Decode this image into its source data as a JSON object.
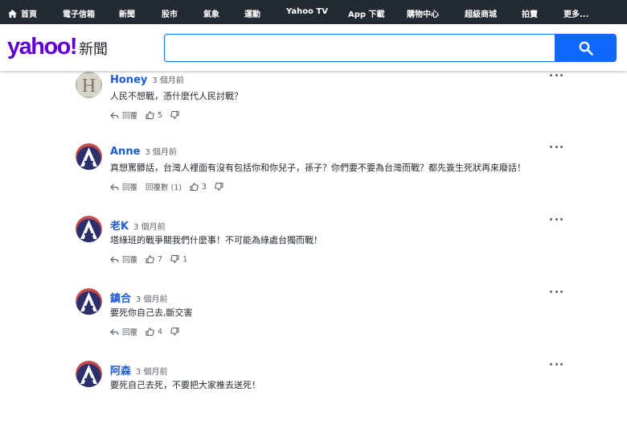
{
  "nav": {
    "items": [
      "首頁",
      "電子信箱",
      "新聞",
      "股市",
      "氣象",
      "運動",
      "Yahoo TV",
      "App 下載",
      "購物中心",
      "超級商城",
      "拍賣",
      "更多..."
    ]
  },
  "header": {
    "logo_text": "yahoo!",
    "section_text": "新聞",
    "search_value": ""
  },
  "comments": [
    {
      "author": "Honey",
      "time": "3 個月前",
      "text": "人民不想戰，憑什麼代人民討戰？",
      "reply_label": "回覆",
      "replies_label": "",
      "likes": "5",
      "dislikes": "",
      "avatar": "letter-H"
    },
    {
      "author": "Anne",
      "time": "3 個月前",
      "text": "真想罵髒話，台灣人裡面有沒有包括你和你兒子，孫子？你們要不要為台灣而戰？都先簽生死狀再來廢話！",
      "reply_label": "回覆",
      "replies_label": "回覆數 (1)",
      "likes": "3",
      "dislikes": "",
      "avatar": "letter-A"
    },
    {
      "author": "老K",
      "time": "3 個月前",
      "text": "塔綠班的戰爭關我們什麼事！不可能為綠處台獨而戰！",
      "reply_label": "回覆",
      "replies_label": "",
      "likes": "7",
      "dislikes": "1",
      "avatar": "letter-A"
    },
    {
      "author": "鎮合",
      "time": "3 個月前",
      "text": "要死你自己去,斷交害",
      "reply_label": "回覆",
      "replies_label": "",
      "likes": "4",
      "dislikes": "",
      "avatar": "letter-A"
    },
    {
      "author": "阿森",
      "time": "3 個月前",
      "text": "要死自己去死，不要把大家推去送死！",
      "reply_label": "",
      "replies_label": "",
      "likes": "",
      "dislikes": "",
      "avatar": "letter-A"
    }
  ],
  "colors": {
    "nav_bg": "#232a31",
    "brand_purple": "#6001d2",
    "link_blue": "#1d5bd6",
    "search_blue": "#0f69ff"
  }
}
